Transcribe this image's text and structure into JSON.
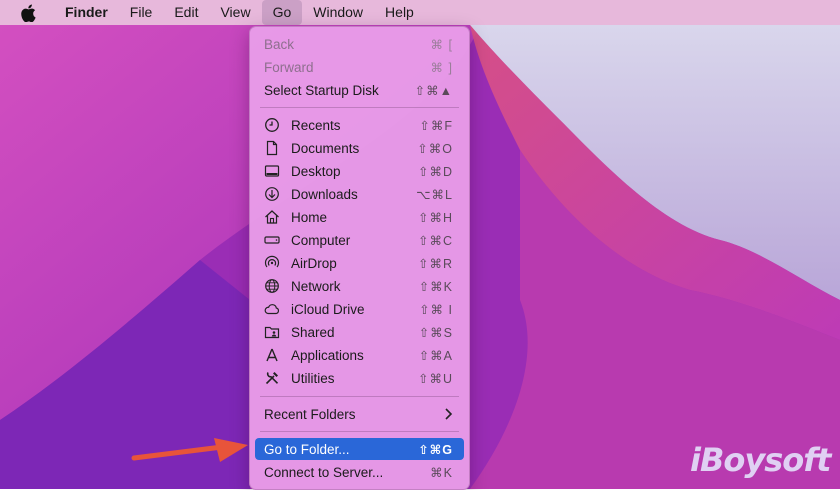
{
  "menubar": {
    "app_name": "Finder",
    "items": [
      "File",
      "Edit",
      "View",
      "Go",
      "Window",
      "Help"
    ]
  },
  "go_menu": {
    "top": [
      {
        "label": "Back",
        "shortcut": "⌘ [",
        "enabled": false
      },
      {
        "label": "Forward",
        "shortcut": "⌘ ]",
        "enabled": false
      },
      {
        "label": "Select Startup Disk",
        "shortcut": "⇧⌘▲",
        "enabled": true
      }
    ],
    "places": [
      {
        "label": "Recents",
        "shortcut": "⇧⌘F",
        "icon": "clock-icon"
      },
      {
        "label": "Documents",
        "shortcut": "⇧⌘O",
        "icon": "document-icon"
      },
      {
        "label": "Desktop",
        "shortcut": "⇧⌘D",
        "icon": "desktop-icon"
      },
      {
        "label": "Downloads",
        "shortcut": "⌥⌘L",
        "icon": "download-icon"
      },
      {
        "label": "Home",
        "shortcut": "⇧⌘H",
        "icon": "home-icon"
      },
      {
        "label": "Computer",
        "shortcut": "⇧⌘C",
        "icon": "computer-icon"
      },
      {
        "label": "AirDrop",
        "shortcut": "⇧⌘R",
        "icon": "airdrop-icon"
      },
      {
        "label": "Network",
        "shortcut": "⇧⌘K",
        "icon": "globe-icon"
      },
      {
        "label": "iCloud Drive",
        "shortcut": "⇧⌘ I",
        "icon": "cloud-icon"
      },
      {
        "label": "Shared",
        "shortcut": "⇧⌘S",
        "icon": "shared-folder-icon"
      },
      {
        "label": "Applications",
        "shortcut": "⇧⌘A",
        "icon": "applications-icon"
      },
      {
        "label": "Utilities",
        "shortcut": "⇧⌘U",
        "icon": "utilities-icon"
      }
    ],
    "recent_folders": {
      "label": "Recent Folders"
    },
    "go_to_folder": {
      "label": "Go to Folder...",
      "shortcut": "⇧⌘G",
      "highlighted": true
    },
    "connect_to_server": {
      "label": "Connect to Server...",
      "shortcut": "⌘K"
    }
  },
  "watermark": {
    "text": "iBoysoft"
  },
  "colors": {
    "menu_background": "#e89ce8",
    "highlight": "#2a67d8",
    "arrow": "#e8543a",
    "desktop": "#a02cb4"
  }
}
